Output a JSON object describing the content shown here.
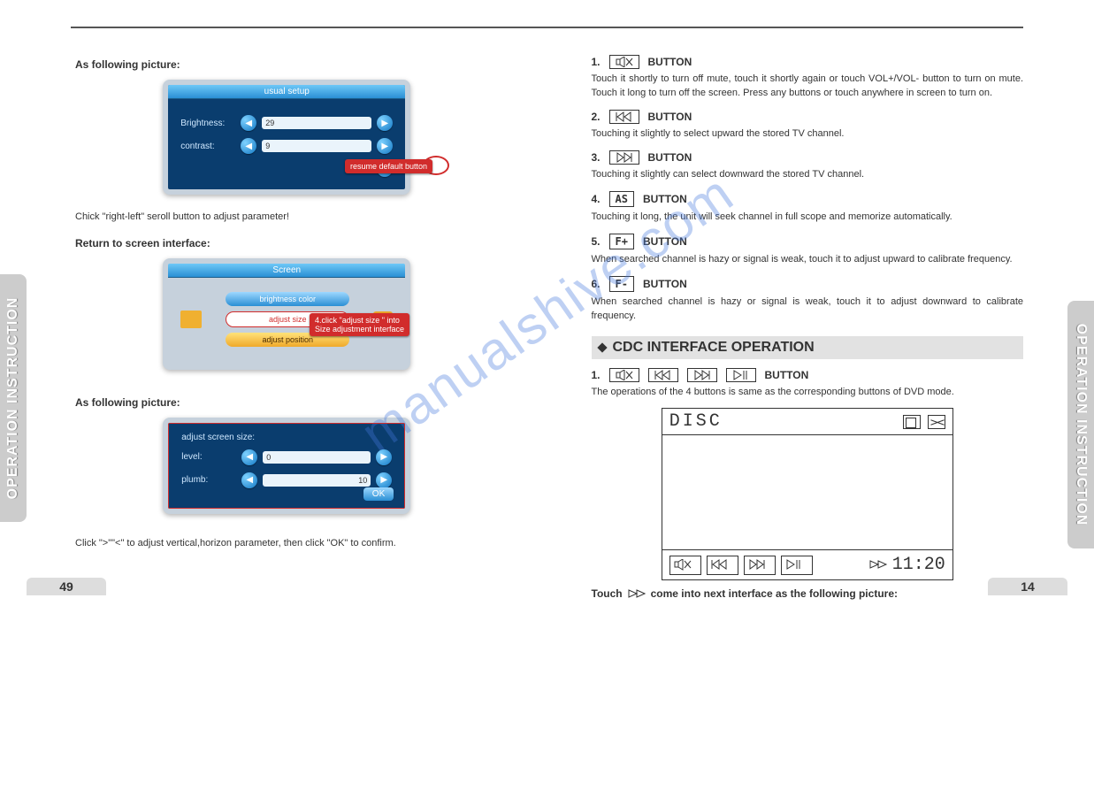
{
  "sideLabel": "OPERATION  INSTRUCTION",
  "pageLeft": "49",
  "pageRight": "14",
  "watermark": "manualshive.com",
  "left": {
    "h1": "As following picture:",
    "panel1_title": "usual setup",
    "panel1_rows": [
      {
        "label": "Brightness:",
        "value": "29"
      },
      {
        "label": "contrast:",
        "value": "9"
      }
    ],
    "callout1": "resume default button",
    "text1": "Chick \"right-left\" seroll button to adjust parameter!",
    "h2": "Return to screen interface:",
    "panel2_title": "Screen",
    "panel2_items": [
      "brightness color",
      "adjust size",
      "adjust position"
    ],
    "callout2a": "4.click \"adjust size \" into",
    "callout2b": "Size adjustment interface",
    "h3": "As following picture:",
    "panel3_heading": "adjust screen size:",
    "panel3_rows": [
      {
        "label": "level:",
        "value": "0"
      },
      {
        "label": "plumb:",
        "value": "10"
      }
    ],
    "panel3_ok": "OK",
    "text2": "Click \">\"\"<\" to adjust vertical,horizon parameter, then click \"OK\" to confirm."
  },
  "right": {
    "buttonsLabel": "BUTTON",
    "items": [
      {
        "n": "1.",
        "icon": "mute",
        "desc": "Touch it shortly to turn off mute, touch it shortly again or touch VOL+/VOL- button to turn on mute. Touch it long to turn off the screen. Press any buttons or touch anywhere  in screen to turn on."
      },
      {
        "n": "2.",
        "icon": "prev",
        "desc": "Touching it slightly to select upward the stored TV channel."
      },
      {
        "n": "3.",
        "icon": "next",
        "desc": "Touching it slightly can select downward the stored TV channel."
      },
      {
        "n": "4.",
        "text": "AS",
        "desc": "Touching it long, the unit will seek channel in full scope and memorize automatically."
      },
      {
        "n": "5.",
        "text": "F+",
        "desc": " When searched channel is hazy or signal is weak, touch it to adjust  upward to calibrate frequency."
      },
      {
        "n": "6.",
        "text": "F-",
        "desc": "When searched channel is hazy or signal is weak, touch it to adjust  downward to calibrate frequency."
      }
    ],
    "sectionTitle": "CDC INTERFACE OPERATION",
    "cdcLine": {
      "n": "1.",
      "desc": "The operations of the 4 buttons is same as the corresponding buttons of DVD mode."
    },
    "discTitle": "DISC",
    "discTime": "11:20",
    "touchLine_a": "Touch",
    "touchLine_b": "come into next interface as the following picture:"
  }
}
